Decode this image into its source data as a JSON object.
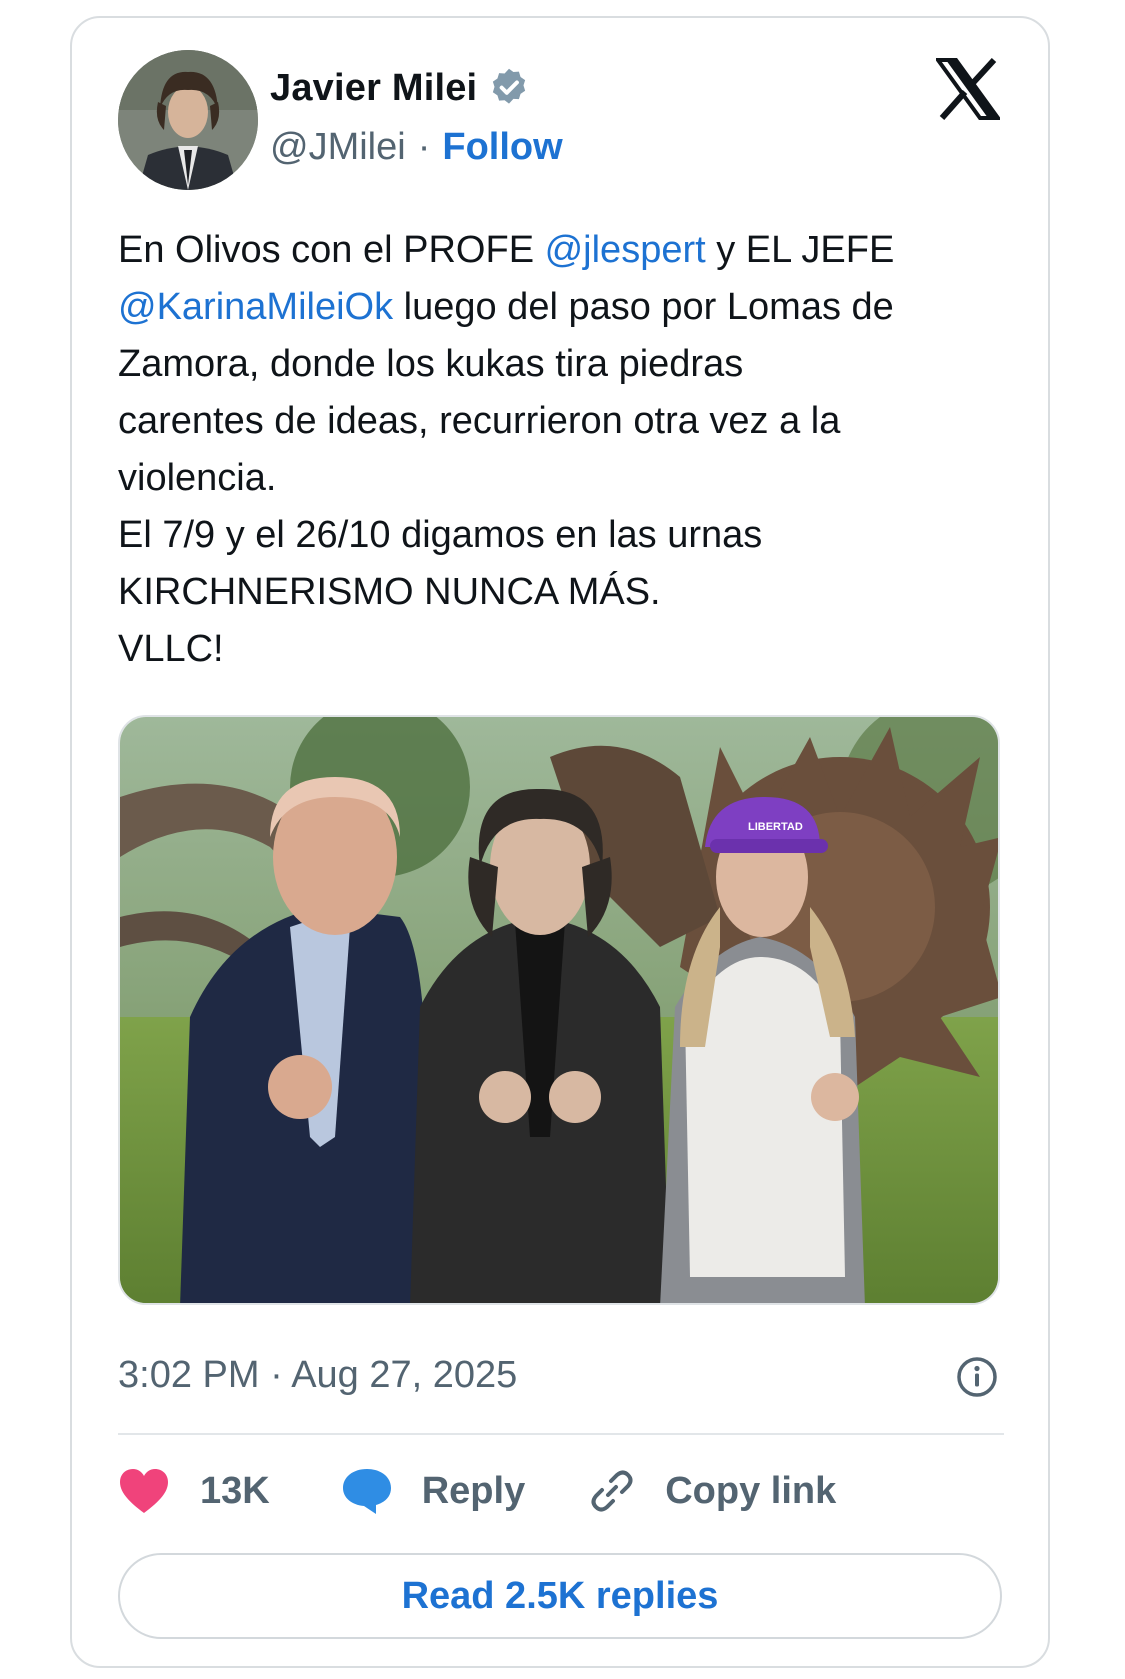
{
  "author": {
    "name": "Javier Milei",
    "handle": "@JMilei",
    "separator": "·",
    "follow_label": "Follow"
  },
  "tweet": {
    "line1_a": "En Olivos con el PROFE ",
    "mention1": "@jlespert",
    "line1_b": " y EL JEFE",
    "mention2": "@KarinaMileiOk",
    "rest": " luego del paso por Lomas de\nZamora, donde los kukas tira piedras\ncarentes de ideas, recurrieron otra vez a la\nviolencia.\nEl 7/9 y el 26/10 digamos en las urnas\nKIRCHNERISMO NUNCA MÁS.\nVLLC!"
  },
  "photo": {
    "cap_text": "LIBERTAD"
  },
  "timestamp": "3:02 PM · Aug 27, 2025",
  "actions": {
    "likes": "13K",
    "reply_label": "Reply",
    "copy_label": "Copy link"
  },
  "read_replies_label": "Read 2.5K replies",
  "colors": {
    "accent": "#1d72d2",
    "like": "#f0437b",
    "reply_icon": "#2f8de4",
    "muted": "#536471",
    "border": "#d9dde0"
  },
  "icons": [
    "verified-badge-icon",
    "x-logo-icon",
    "info-icon",
    "heart-icon",
    "reply-bubble-icon",
    "link-icon"
  ]
}
